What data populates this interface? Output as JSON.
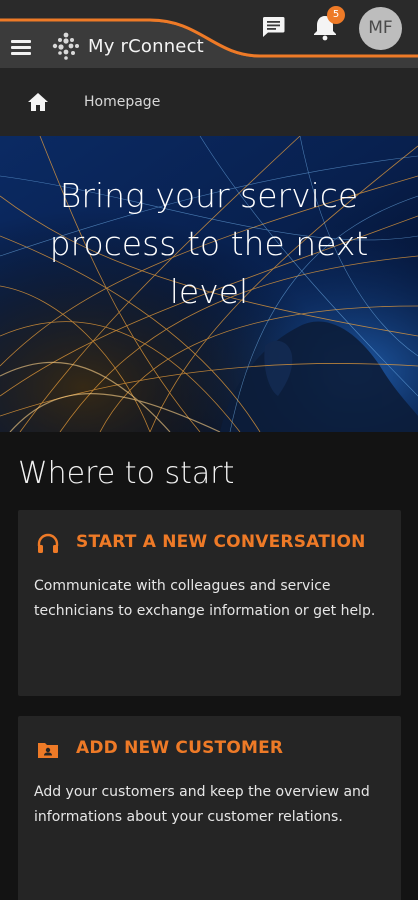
{
  "header": {
    "app_title": "My rConnect",
    "notification_count": "5",
    "avatar_initials": "MF",
    "icons": {
      "menu": "hamburger-menu-icon",
      "logo": "rconnect-logo-icon",
      "chat": "chat-bubble-icon",
      "bell": "bell-icon"
    },
    "accent_color": "#ee7a27"
  },
  "breadcrumb": {
    "home_icon": "home-icon",
    "current": "Homepage"
  },
  "hero": {
    "title": "Bring your service process to the next level"
  },
  "section": {
    "title": "Where to start"
  },
  "cards": [
    {
      "icon": "headset-icon",
      "title": "START A NEW CONVERSATION",
      "text": "Communicate with colleagues and service technicians to exchange information or get help."
    },
    {
      "icon": "folder-person-icon",
      "title": "ADD NEW CUSTOMER",
      "text": "Add your customers and keep the overview and informations about your customer relations."
    }
  ]
}
